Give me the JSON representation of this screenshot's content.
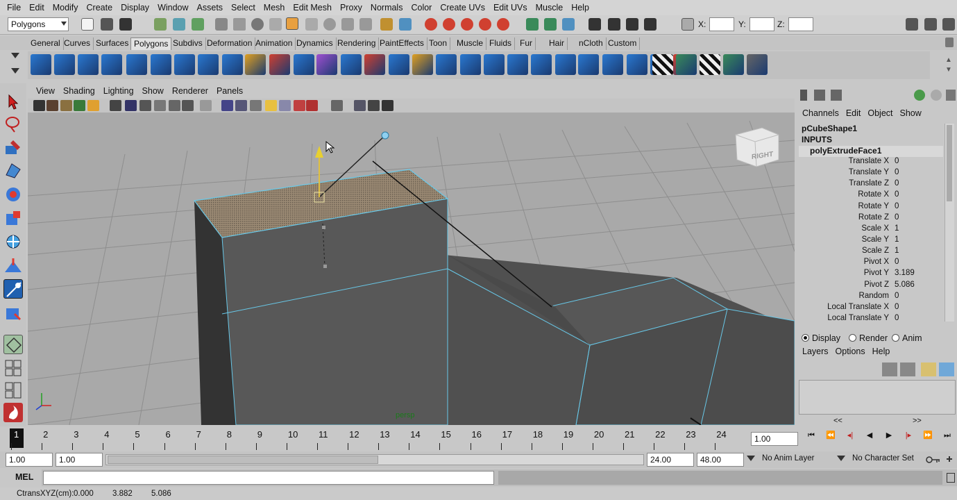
{
  "menubar": [
    "File",
    "Edit",
    "Modify",
    "Create",
    "Display",
    "Window",
    "Assets",
    "Select",
    "Mesh",
    "Edit Mesh",
    "Proxy",
    "Normals",
    "Color",
    "Create UVs",
    "Edit UVs",
    "Muscle",
    "Help"
  ],
  "status": {
    "mode": "Polygons",
    "x_label": "X:",
    "y_label": "Y:",
    "z_label": "Z:"
  },
  "shelf_tabs": [
    "General",
    "Curves",
    "Surfaces",
    "Polygons",
    "Subdivs",
    "Deformation",
    "Animation",
    "Dynamics",
    "Rendering",
    "PaintEffects",
    "Toon",
    "Muscle",
    "Fluids",
    "Fur",
    "Hair",
    "nCloth",
    "Custom"
  ],
  "active_shelf": "Polygons",
  "panel_menu": [
    "View",
    "Shading",
    "Lighting",
    "Show",
    "Renderer",
    "Panels"
  ],
  "viewport": {
    "camera_label": "persp",
    "viewcube_label": "RIGHT"
  },
  "channelbox": {
    "menu": [
      "Channels",
      "Edit",
      "Object",
      "Show"
    ],
    "shape": "pCubeShape1",
    "inputs": "INPUTS",
    "node": "polyExtrudeFace1",
    "rows": [
      {
        "label": "Translate X",
        "value": "0"
      },
      {
        "label": "Translate Y",
        "value": "0"
      },
      {
        "label": "Translate Z",
        "value": "0"
      },
      {
        "label": "Rotate X",
        "value": "0"
      },
      {
        "label": "Rotate Y",
        "value": "0"
      },
      {
        "label": "Rotate Z",
        "value": "0"
      },
      {
        "label": "Scale X",
        "value": "1"
      },
      {
        "label": "Scale Y",
        "value": "1"
      },
      {
        "label": "Scale Z",
        "value": "1"
      },
      {
        "label": "Pivot X",
        "value": "0"
      },
      {
        "label": "Pivot Y",
        "value": "3.189"
      },
      {
        "label": "Pivot Z",
        "value": "5.086"
      },
      {
        "label": "Random",
        "value": "0"
      },
      {
        "label": "Local Translate X",
        "value": "0"
      },
      {
        "label": "Local Translate Y",
        "value": "0"
      }
    ]
  },
  "layers": {
    "display": "Display",
    "render": "Render",
    "anim": "Anim",
    "menu": [
      "Layers",
      "Options",
      "Help"
    ],
    "prev": "<<",
    "next": ">>"
  },
  "timeline": {
    "ticks": [
      "1",
      "2",
      "3",
      "4",
      "5",
      "6",
      "7",
      "8",
      "9",
      "10",
      "11",
      "12",
      "13",
      "14",
      "15",
      "16",
      "17",
      "18",
      "19",
      "20",
      "21",
      "22",
      "23",
      "24"
    ],
    "current": "1",
    "current_field": "1.00"
  },
  "range": {
    "start": "1.00",
    "start2": "1.00",
    "end": "24.00",
    "end2": "48.00",
    "anim_layer": "No Anim Layer",
    "char_set": "No Character Set"
  },
  "cmd": {
    "label": "MEL"
  },
  "help": {
    "label": "CtransXYZ(cm):",
    "x": "0.000",
    "y": "3.882",
    "z": "5.086"
  }
}
